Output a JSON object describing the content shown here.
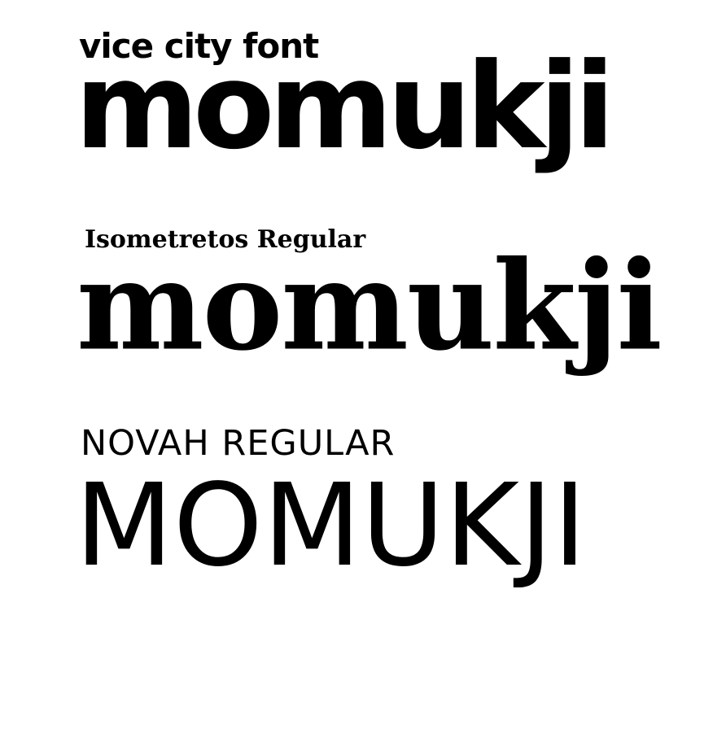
{
  "specimens": [
    {
      "label": "vice city font",
      "sample": "momukji"
    },
    {
      "label": "Isometretos Regular",
      "sample": "momukji"
    },
    {
      "label": "NOVAH REGULAR",
      "sample": "MOMUKJI"
    }
  ],
  "colors": {
    "background": "#ffffff",
    "text": "#000000"
  }
}
